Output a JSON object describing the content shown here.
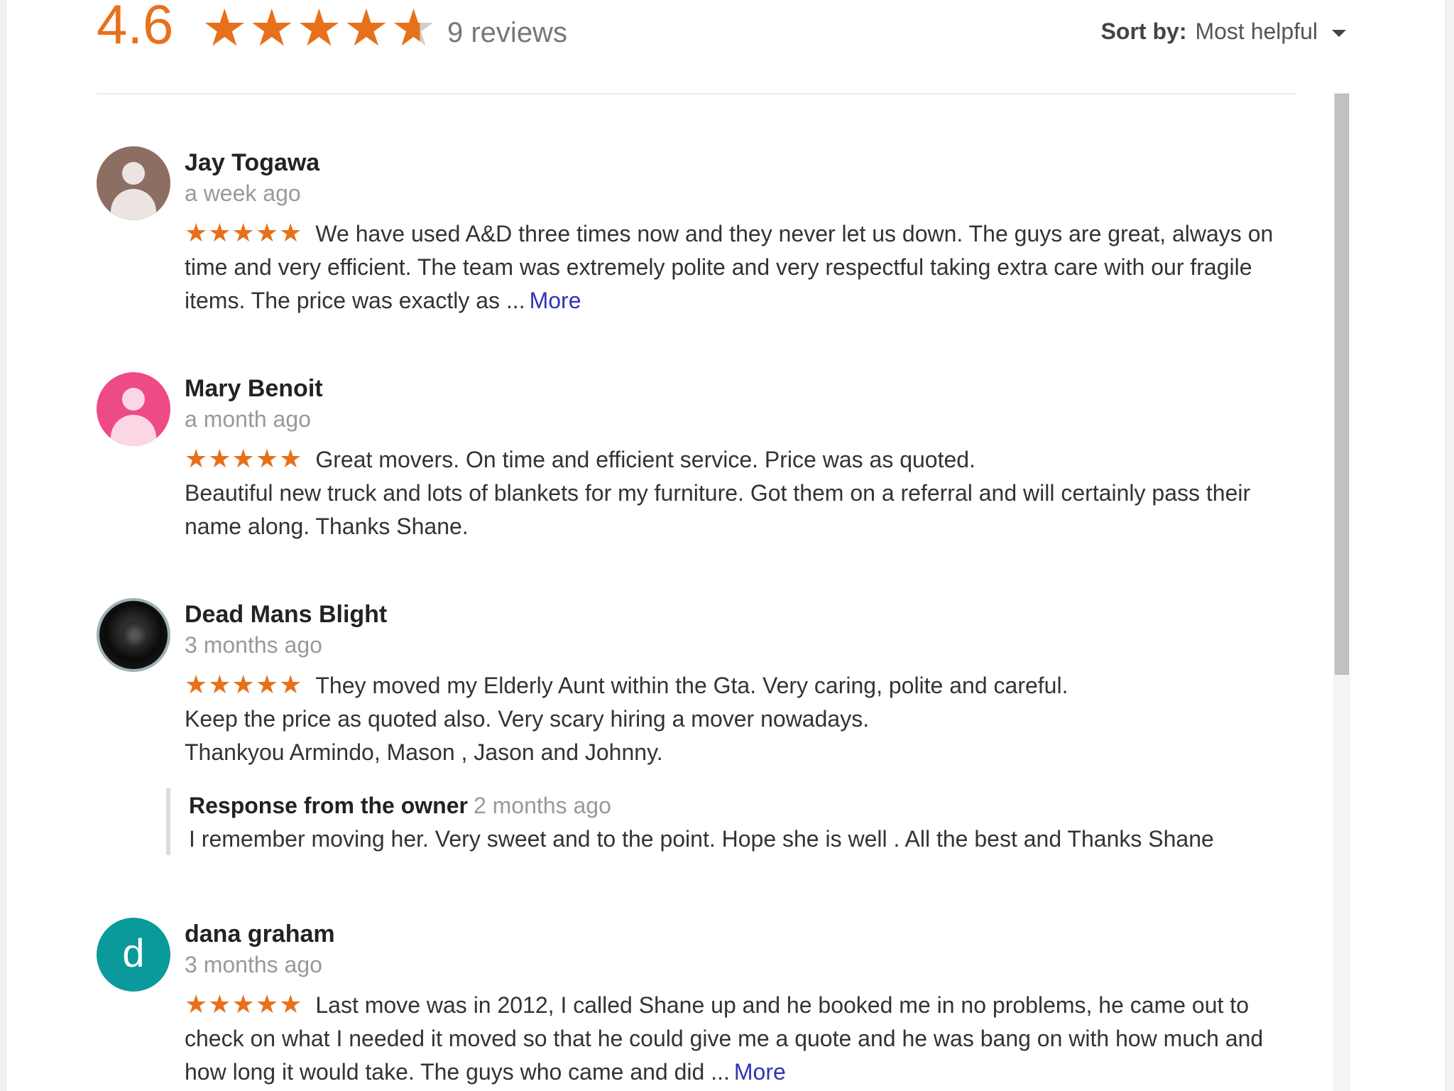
{
  "summary": {
    "rating": "4.6",
    "stars_value": 4.6,
    "review_count": "9 reviews"
  },
  "sort": {
    "label": "Sort by:",
    "value": "Most helpful"
  },
  "colors": {
    "star": "#e7711b",
    "link": "#3033b8"
  },
  "reviews": [
    {
      "name": "Jay Togawa",
      "time": "a week ago",
      "stars": "★★★★★",
      "text": "We have used A&D three times now and they never let us down.  The guys are great, always on time and very efficient.   The team was extremely polite and very respectful taking extra care with our fragile items.  The price was exactly as ...",
      "more": "More",
      "avatar": "person-icon"
    },
    {
      "name": "Mary Benoit",
      "time": "a month ago",
      "stars": "★★★★★",
      "line1": "Great movers. On time and efficient service. Price was as quoted.",
      "line2": "Beautiful new truck and lots of blankets for my furniture. Got them on a referral and will certainly pass their name along. Thanks Shane.",
      "avatar": "person-icon"
    },
    {
      "name": "Dead Mans Blight",
      "time": "3 months ago",
      "stars": "★★★★★",
      "line1": "They moved my Elderly Aunt within the Gta. Very caring, polite and careful.",
      "line2": "Keep the price as quoted also. Very scary hiring a mover nowadays.",
      "line3": "Thankyou Armindo, Mason , Jason and Johnny.",
      "response": {
        "label": "Response from the owner",
        "time": "2 months ago",
        "text": "I remember moving her. Very sweet and to the point. Hope she is well . All the best and Thanks Shane"
      },
      "avatar": "photo"
    },
    {
      "name": "dana graham",
      "time": "3 months ago",
      "stars": "★★★★★",
      "text": "Last move was in 2012, I called Shane up and he booked me in no problems, he came out to check on what I needed it moved so that he could give me a quote and he was bang on with how much and how long it would take. The guys who came and did ...",
      "more": "More",
      "avatar_letter": "d"
    }
  ]
}
